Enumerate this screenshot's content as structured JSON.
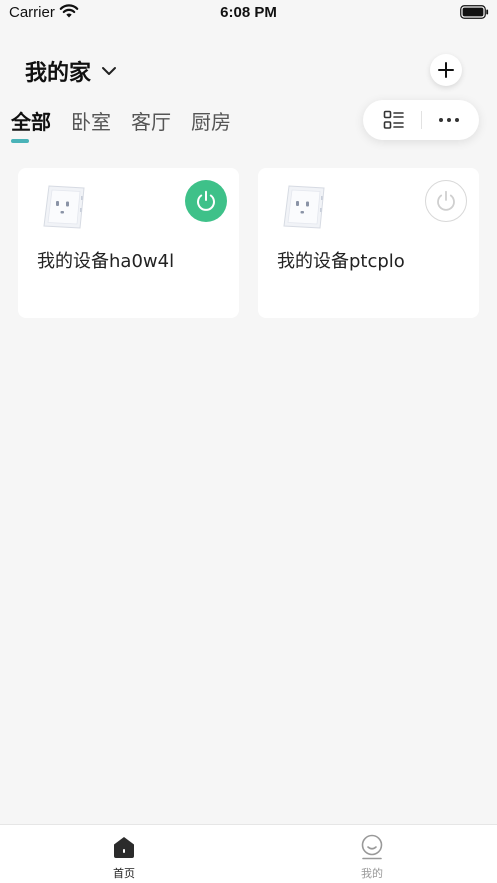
{
  "status_bar": {
    "carrier": "Carrier",
    "time": "6:08 PM",
    "wifi_icon": "wifi-icon",
    "battery_icon": "battery-icon"
  },
  "header": {
    "home_name": "我的家",
    "dropdown_icon": "chevron-down-icon",
    "add_icon": "plus-icon"
  },
  "tabs": [
    {
      "label": "全部",
      "active": true
    },
    {
      "label": "卧室",
      "active": false
    },
    {
      "label": "客厅",
      "active": false
    },
    {
      "label": "厨房",
      "active": false
    }
  ],
  "toolbar": {
    "list_icon": "list-view-icon",
    "more_icon": "more-dots-icon"
  },
  "devices": [
    {
      "name": "我的设备ha0w4l",
      "power_on": true,
      "image": "wall-socket-icon"
    },
    {
      "name": "我的设备ptcplo",
      "power_on": false,
      "image": "wall-socket-icon"
    }
  ],
  "bottom_nav": [
    {
      "label": "首页",
      "icon": "home-icon",
      "active": true
    },
    {
      "label": "我的",
      "icon": "profile-icon",
      "active": false
    }
  ],
  "colors": {
    "accent": "#4ab3b8",
    "power_on": "#3ec189",
    "background": "#f6f6f6"
  }
}
